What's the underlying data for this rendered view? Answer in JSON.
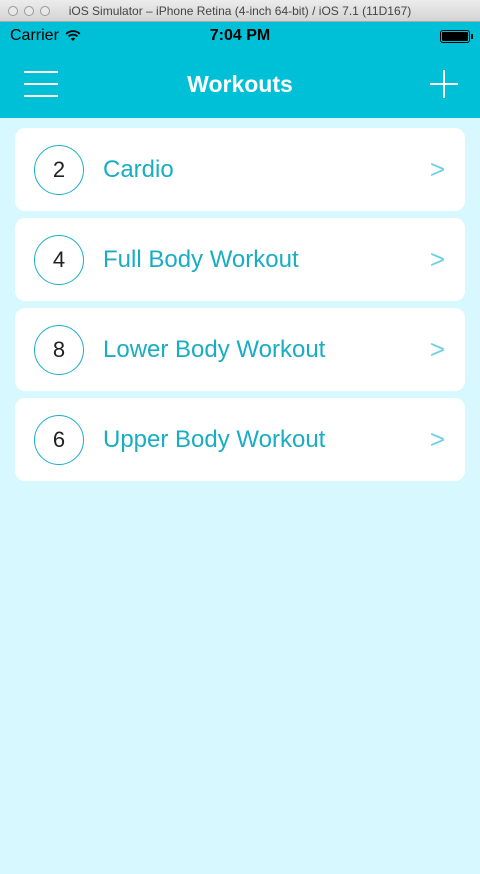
{
  "window": {
    "title": "iOS Simulator – iPhone Retina (4-inch 64-bit) / iOS 7.1 (11D167)"
  },
  "status_bar": {
    "carrier": "Carrier",
    "time": "7:04 PM",
    "battery_level": 1.0
  },
  "nav_bar": {
    "title": "Workouts",
    "left_icon": "hamburger-menu-icon",
    "right_icon": "plus-icon"
  },
  "workouts": [
    {
      "count": "2",
      "name": "Cardio",
      "chevron": ">"
    },
    {
      "count": "4",
      "name": "Full Body Workout",
      "chevron": ">"
    },
    {
      "count": "8",
      "name": "Lower Body Workout",
      "chevron": ">"
    },
    {
      "count": "6",
      "name": "Upper Body Workout",
      "chevron": ">"
    }
  ],
  "colors": {
    "accent": "#00c0d8",
    "background": "#d6f8fe",
    "label": "#19adc4"
  }
}
